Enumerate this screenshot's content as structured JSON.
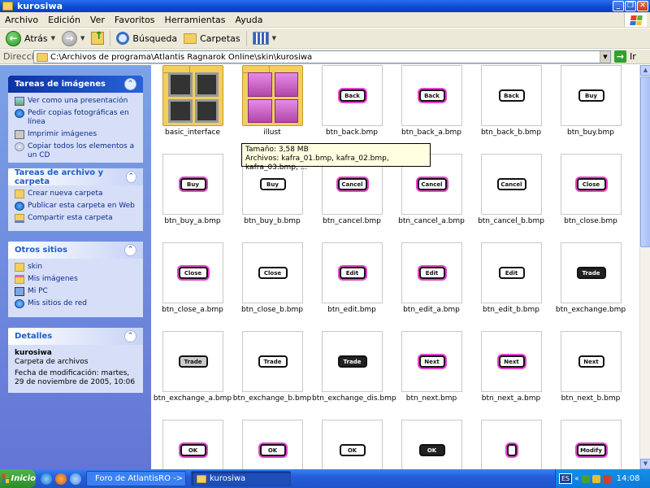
{
  "window": {
    "title": "kurosiwa"
  },
  "menu": [
    "Archivo",
    "Edición",
    "Ver",
    "Favoritos",
    "Herramientas",
    "Ayuda"
  ],
  "toolbar": {
    "back_label": "Atrás",
    "search_label": "Búsqueda",
    "folders_label": "Carpetas"
  },
  "address": {
    "label": "Dirección",
    "path": "C:\\Archivos de programa\\Atlantis Ragnarok Online\\skin\\kurosiwa",
    "go_label": "Ir"
  },
  "taskpane": {
    "image_tasks": {
      "title": "Tareas de imágenes",
      "items": [
        {
          "label": "Ver como una presentación",
          "icon": "slideshow-icon"
        },
        {
          "label": "Pedir copias fotográficas en línea",
          "icon": "order-prints-icon"
        },
        {
          "label": "Imprimir imágenes",
          "icon": "printer-icon"
        },
        {
          "label": "Copiar todos los elementos a un CD",
          "icon": "cd-icon"
        }
      ]
    },
    "file_tasks": {
      "title": "Tareas de archivo y carpeta",
      "items": [
        {
          "label": "Crear nueva carpeta",
          "icon": "new-folder-icon"
        },
        {
          "label": "Publicar esta carpeta en Web",
          "icon": "web-publish-icon"
        },
        {
          "label": "Compartir esta carpeta",
          "icon": "share-folder-icon"
        }
      ]
    },
    "other_places": {
      "title": "Otros sitios",
      "items": [
        {
          "label": "skin",
          "icon": "folder-icon"
        },
        {
          "label": "Mis imágenes",
          "icon": "my-pictures-icon"
        },
        {
          "label": "Mi PC",
          "icon": "my-computer-icon"
        },
        {
          "label": "Mis sitios de red",
          "icon": "network-places-icon"
        }
      ]
    },
    "details": {
      "title": "Detalles",
      "name": "kurosiwa",
      "type": "Carpeta de archivos",
      "modified": "Fecha de modificación: martes, 29 de noviembre de 2005, 10:06"
    }
  },
  "files": [
    {
      "name": "basic_interface",
      "kind": "folder-basic"
    },
    {
      "name": "illust",
      "kind": "folder-illust"
    },
    {
      "name": "btn_back.bmp",
      "glyph": "Back",
      "style": "pink"
    },
    {
      "name": "btn_back_a.bmp",
      "glyph": "Back",
      "style": "pink"
    },
    {
      "name": "btn_back_b.bmp",
      "glyph": "Back",
      "style": "plain"
    },
    {
      "name": "btn_buy.bmp",
      "glyph": "Buy",
      "style": "plain"
    },
    {
      "name": "btn_buy_a.bmp",
      "glyph": "Buy",
      "style": "pink"
    },
    {
      "name": "btn_buy_b.bmp",
      "glyph": "Buy",
      "style": "plain"
    },
    {
      "name": "btn_cancel.bmp",
      "glyph": "Cancel",
      "style": "pink"
    },
    {
      "name": "btn_cancel_a.bmp",
      "glyph": "Cancel",
      "style": "pink"
    },
    {
      "name": "btn_cancel_b.bmp",
      "glyph": "Cancel",
      "style": "plain"
    },
    {
      "name": "btn_close.bmp",
      "glyph": "Close",
      "style": "pink"
    },
    {
      "name": "btn_close_a.bmp",
      "glyph": "Close",
      "style": "pink"
    },
    {
      "name": "btn_close_b.bmp",
      "glyph": "Close",
      "style": "plain"
    },
    {
      "name": "btn_edit.bmp",
      "glyph": "Edit",
      "style": "pink"
    },
    {
      "name": "btn_edit_a.bmp",
      "glyph": "Edit",
      "style": "pink"
    },
    {
      "name": "btn_edit_b.bmp",
      "glyph": "Edit",
      "style": "plain"
    },
    {
      "name": "btn_exchange.bmp",
      "glyph": "Trade",
      "style": "dark"
    },
    {
      "name": "btn_exchange_a.bmp",
      "glyph": "Trade",
      "style": "grey"
    },
    {
      "name": "btn_exchange_b.bmp",
      "glyph": "Trade",
      "style": "plain"
    },
    {
      "name": "btn_exchange_dis.bmp",
      "glyph": "Trade",
      "style": "dark"
    },
    {
      "name": "btn_next.bmp",
      "glyph": "Next",
      "style": "pink"
    },
    {
      "name": "btn_next_a.bmp",
      "glyph": "Next",
      "style": "pink"
    },
    {
      "name": "btn_next_b.bmp",
      "glyph": "Next",
      "style": "plain"
    },
    {
      "name": "",
      "glyph": "OK",
      "style": "pink"
    },
    {
      "name": "",
      "glyph": "OK",
      "style": "pink"
    },
    {
      "name": "",
      "glyph": "OK",
      "style": "plain"
    },
    {
      "name": "",
      "glyph": "OK",
      "style": "dark"
    },
    {
      "name": "",
      "glyph": "",
      "style": "pink"
    },
    {
      "name": "",
      "glyph": "Modify",
      "style": "pink"
    }
  ],
  "tooltip": {
    "line1": "Tamaño: 3,58 MB",
    "line2": "Archivos: kafra_01.bmp, kafra_02.bmp, kafra_03.bmp, ..."
  },
  "taskbar": {
    "start_label": "Inicio",
    "windows": [
      {
        "label": "Foro de AtlantisRO -> In...",
        "active": false
      },
      {
        "label": "kurosiwa",
        "active": true
      }
    ],
    "lang": "ES",
    "clock": "14:08"
  }
}
